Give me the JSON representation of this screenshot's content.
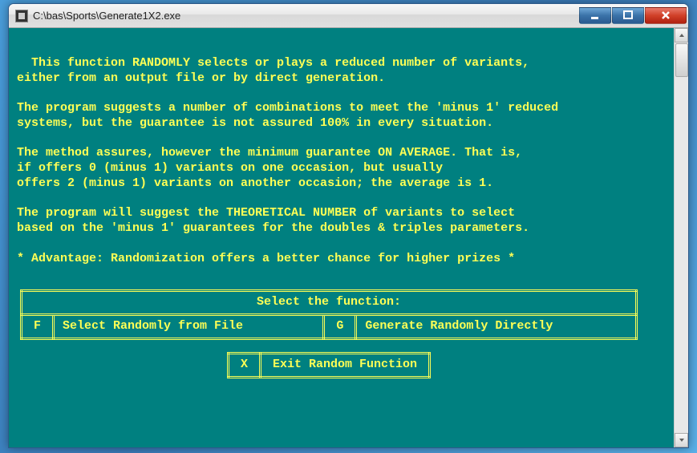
{
  "window": {
    "title": "C:\\bas\\Sports\\Generate1X2.exe"
  },
  "console": {
    "lines": [
      "  This function RANDOMLY selects or plays a reduced number of variants,",
      "either from an output file or by direct generation.",
      "",
      "The program suggests a number of combinations to meet the 'minus 1' reduced",
      "systems, but the guarantee is not assured 100% in every situation.",
      "",
      "The method assures, however the minimum guarantee ON AVERAGE. That is,",
      "if offers 0 (minus 1) variants on one occasion, but usually",
      "offers 2 (minus 1) variants on another occasion; the average is 1.",
      "",
      "The program will suggest the THEORETICAL NUMBER of variants to select",
      "based on the 'minus 1' guarantees for the doubles & triples parameters.",
      "",
      "* Advantage: Randomization offers a better chance for higher prizes *"
    ]
  },
  "menu": {
    "header": "Select the function:",
    "options": {
      "F": {
        "key": "F",
        "label": "Select Randomly from File"
      },
      "G": {
        "key": "G",
        "label": "Generate Randomly Directly"
      },
      "X": {
        "key": "X",
        "label": "Exit Random Function"
      }
    }
  },
  "colors": {
    "console_bg": "#008080",
    "console_fg": "#ffff55"
  }
}
